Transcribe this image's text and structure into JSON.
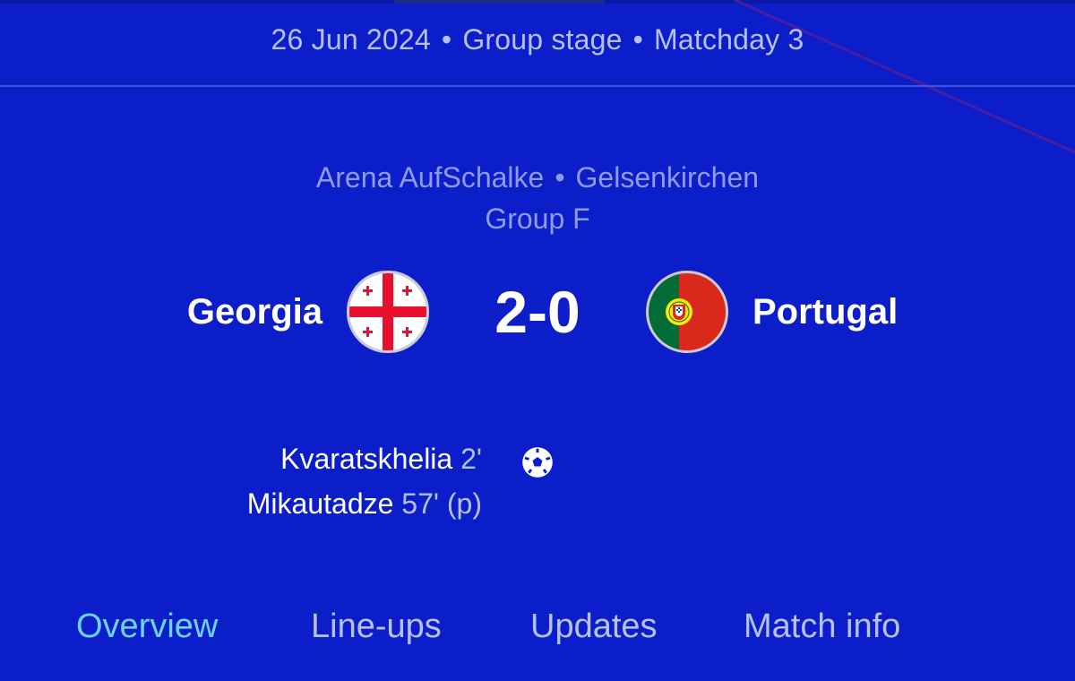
{
  "header": {
    "date": "26 Jun 2024",
    "stage": "Group stage",
    "matchday": "Matchday 3",
    "separator": "•"
  },
  "venue": {
    "stadium": "Arena AufSchalke",
    "city": "Gelsenkirchen",
    "separator": "•",
    "group": "Group F"
  },
  "match": {
    "home_team": "Georgia",
    "away_team": "Portugal",
    "score": "2-0",
    "home_flag_icon": "georgia-flag-icon",
    "away_flag_icon": "portugal-flag-icon"
  },
  "scorers": [
    {
      "name": "Kvaratskhelia",
      "minute": "2'",
      "note": ""
    },
    {
      "name": "Mikautadze",
      "minute": "57'",
      "note": "(p)"
    }
  ],
  "goal_icon": "football-icon",
  "tabs": [
    {
      "label": "Overview",
      "active": true
    },
    {
      "label": "Line-ups",
      "active": false
    },
    {
      "label": "Updates",
      "active": false
    },
    {
      "label": "Match info",
      "active": false
    }
  ],
  "colors": {
    "background": "#0b1ec9",
    "active_tab": "#6fd3f5",
    "muted_text": "#b7c0f2"
  }
}
